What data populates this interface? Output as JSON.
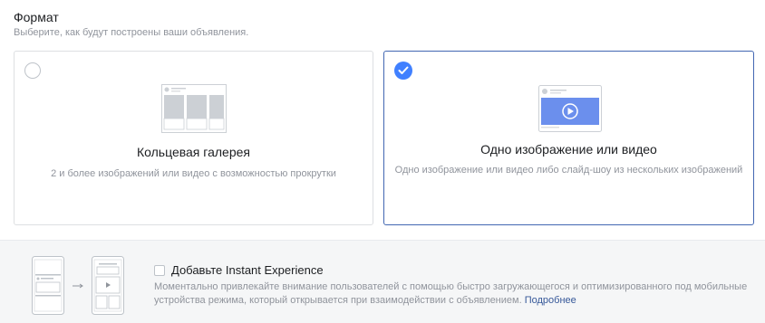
{
  "format": {
    "title": "Формат",
    "subtitle": "Выберите, как будут построены ваши объявления."
  },
  "options": [
    {
      "title": "Кольцевая галерея",
      "description": "2 и более изображений или видео с возможностью прокрутки",
      "selected": false,
      "icon": "carousel-illustration"
    },
    {
      "title": "Одно изображение или видео",
      "description": "Одно изображение или видео либо слайд-шоу из нескольких изображений",
      "selected": true,
      "icon": "single-image-video-illustration"
    }
  ],
  "instant_experience": {
    "checkbox_label": "Добавьте Instant Experience",
    "checked": false,
    "description": "Моментально привлекайте внимание пользователей с помощью быстро загружающегося и оптимизированного под мобильные устройства режима, который открывается при взаимодействии с объявлением.",
    "link": "Подробнее",
    "icon": "instant-experience-illustration"
  },
  "colors": {
    "accent": "#4080ff",
    "selected_border": "#4267b2",
    "link": "#365899",
    "muted_text": "#90949c",
    "panel_bg": "#f5f6f7"
  }
}
